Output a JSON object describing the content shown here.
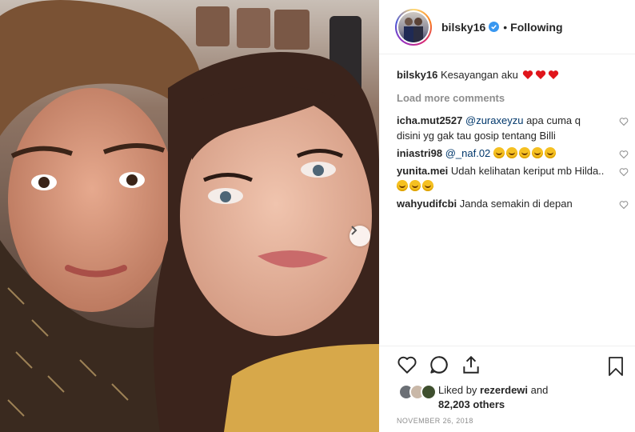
{
  "post": {
    "username": "bilsky16",
    "separator": "•",
    "follow_status": "Following",
    "caption_user": "bilsky16",
    "caption_text": "Kesayangan aku",
    "load_more": "Load more comments"
  },
  "comments": [
    {
      "user": "icha.mut2527",
      "mention": "@zuraxeyzu",
      "text": " apa cuma q disini yg gak tau gosip tentang Billi"
    },
    {
      "user": "iniastri98",
      "mention": "@_naf.02",
      "text": ""
    },
    {
      "user": "yunita.mei",
      "mention": "",
      "text": " Udah kelihatan keriput mb Hilda.."
    },
    {
      "user": "wahyudifcbi",
      "mention": "",
      "text": " Janda semakin di depan"
    }
  ],
  "likes": {
    "prefix": "Liked by ",
    "user": "rezerdewi",
    "middle": " and",
    "count": "82,203 others"
  },
  "date": "NOVEMBER 26, 2018",
  "colors": {
    "link": "#00376b",
    "verified": "#3897f0",
    "heart": "#ed4956",
    "muted": "#8e8e8e"
  },
  "icons": [
    "verified-badge-icon",
    "heart-icon",
    "comment-icon",
    "share-icon",
    "bookmark-icon",
    "next-arrow-icon"
  ]
}
